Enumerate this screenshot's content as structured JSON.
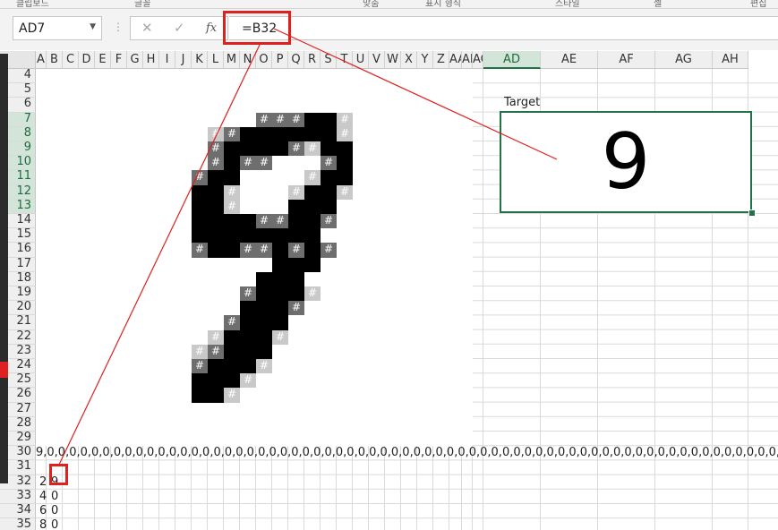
{
  "ribbon": {
    "fragments": [
      "클립보드",
      "글꼴",
      "맞춤",
      "표시 형식",
      "스타일",
      "셀",
      "편집"
    ]
  },
  "name_box": {
    "value": "AD7",
    "dropdown_icon": "chevron-down-icon"
  },
  "formula_bar": {
    "cancel_icon": "✕",
    "enter_icon": "✓",
    "function_icon": "fx",
    "formula": "=B32"
  },
  "columns": [
    "A",
    "B",
    "C",
    "D",
    "E",
    "F",
    "G",
    "H",
    "I",
    "J",
    "K",
    "L",
    "M",
    "N",
    "O",
    "P",
    "Q",
    "R",
    "S",
    "T",
    "U",
    "V",
    "W",
    "X",
    "Y",
    "Z",
    "AA",
    "AB",
    "AC",
    "AD",
    "AE",
    "AF",
    "AG",
    "AH"
  ],
  "selected_column": "AD",
  "rows": [
    "4",
    "5",
    "6",
    "7",
    "8",
    "9",
    "10",
    "11",
    "12",
    "13",
    "14",
    "15",
    "16",
    "17",
    "18",
    "19",
    "20",
    "21",
    "22",
    "23",
    "24",
    "25",
    "26",
    "27",
    "28",
    "29",
    "30",
    "31",
    "32",
    "33",
    "34",
    "35"
  ],
  "selected_rows": [
    "7",
    "8",
    "9",
    "10",
    "11",
    "12",
    "13"
  ],
  "cell_marker": "#",
  "digit_image": {
    "description_rows": "row 7 .. row 26, columns J .. T",
    "levels": [
      [
        0,
        0,
        0,
        0,
        0,
        0,
        0,
        0,
        0,
        0,
        0
      ],
      [
        0,
        0,
        0,
        0,
        0,
        2,
        2,
        2,
        3,
        3,
        1
      ],
      [
        0,
        0,
        1,
        2,
        3,
        3,
        3,
        3,
        3,
        3,
        1
      ],
      [
        0,
        0,
        2,
        3,
        3,
        3,
        3,
        2,
        1,
        3,
        3
      ],
      [
        0,
        0,
        2,
        3,
        2,
        2,
        0,
        0,
        0,
        2,
        3
      ],
      [
        0,
        2,
        3,
        3,
        0,
        0,
        0,
        0,
        1,
        3,
        3
      ],
      [
        0,
        3,
        3,
        1,
        0,
        0,
        0,
        1,
        3,
        3,
        1
      ],
      [
        0,
        3,
        3,
        1,
        0,
        0,
        0,
        3,
        3,
        3,
        0
      ],
      [
        0,
        3,
        3,
        3,
        3,
        2,
        2,
        3,
        3,
        2,
        0
      ],
      [
        0,
        3,
        3,
        3,
        3,
        3,
        3,
        3,
        3,
        0,
        0
      ],
      [
        0,
        2,
        3,
        3,
        2,
        2,
        3,
        2,
        3,
        2,
        0
      ],
      [
        0,
        0,
        0,
        0,
        0,
        0,
        3,
        3,
        3,
        0,
        0
      ],
      [
        0,
        0,
        0,
        0,
        0,
        3,
        3,
        3,
        0,
        0,
        0
      ],
      [
        0,
        0,
        0,
        0,
        2,
        3,
        3,
        3,
        1,
        0,
        0
      ],
      [
        0,
        0,
        0,
        0,
        3,
        3,
        3,
        2,
        0,
        0,
        0
      ],
      [
        0,
        0,
        0,
        2,
        3,
        3,
        3,
        0,
        0,
        0,
        0
      ],
      [
        0,
        0,
        1,
        3,
        3,
        3,
        1,
        0,
        0,
        0,
        0
      ],
      [
        0,
        1,
        2,
        3,
        3,
        3,
        0,
        0,
        0,
        0,
        0
      ],
      [
        0,
        2,
        3,
        3,
        3,
        1,
        0,
        0,
        0,
        0,
        0
      ],
      [
        0,
        3,
        3,
        3,
        1,
        0,
        0,
        0,
        0,
        0,
        0
      ],
      [
        0,
        3,
        3,
        1,
        0,
        0,
        0,
        0,
        0,
        0,
        0
      ]
    ]
  },
  "row30_text": "9,0,0,0,0,0,0,0,0,0,0,0,0,0,0,0,0,0,0,0,0,0,0,0,0,0,0,0,0,0,0,0,0,0,0,0,0,0,0,0,0,0,0,0,0,0,0,0,0,0,0,0,0,0,0,0,0,0,0,0,0,0,0,0,0,0,0,0,0,0,0,0,0,0,0,0,0,0,0,0,0,0,0,0,0",
  "lower_cells": [
    {
      "row": "32",
      "a": "2",
      "b": "9"
    },
    {
      "row": "33",
      "a": "4",
      "b": "0"
    },
    {
      "row": "34",
      "a": "6",
      "b": "0"
    },
    {
      "row": "35",
      "a": "8",
      "b": "0"
    }
  ],
  "target": {
    "label": "Target",
    "value": "9"
  },
  "colors": {
    "excel_green": "#217346",
    "highlight_red": "#e0201c",
    "header_bg": "#efefef",
    "selected_header_bg": "#d3e4d9"
  }
}
